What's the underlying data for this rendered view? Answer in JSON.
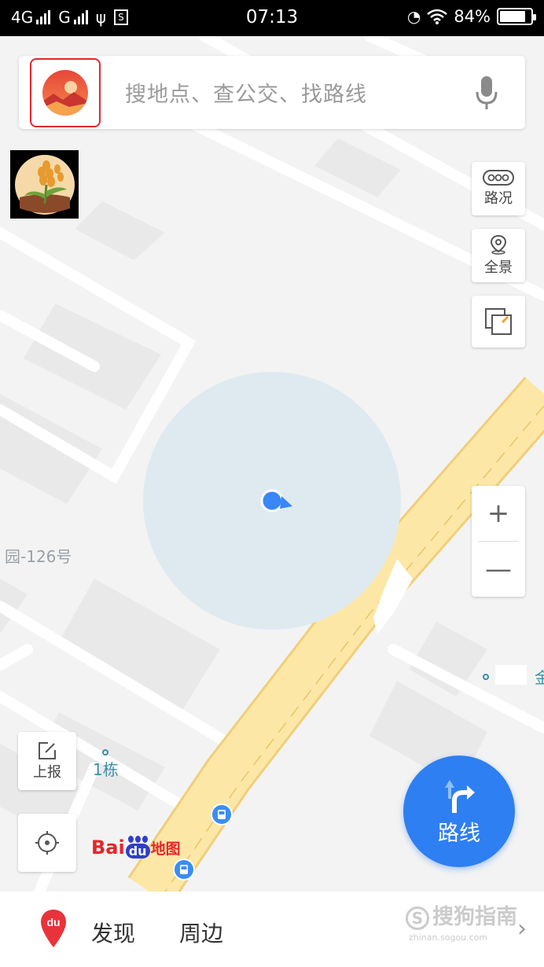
{
  "status_bar": {
    "network_1": "4G",
    "network_2": "G",
    "time": "07:13",
    "battery_percent": "84%",
    "battery_level": 0.84
  },
  "search": {
    "placeholder": "搜地点、查公交、找路线"
  },
  "side_controls": {
    "traffic_label": "路况",
    "panorama_label": "全景"
  },
  "zoom": {
    "in_symbol": "+",
    "out_symbol": "—"
  },
  "map_labels": {
    "address": "园-126号",
    "building": "1栋",
    "poi_right": "金"
  },
  "report_button": {
    "label": "上报"
  },
  "route_button": {
    "label": "路线"
  },
  "logo": {
    "bai": "Bai",
    "du": "du",
    "map": "地图"
  },
  "bottom_bar": {
    "discover_prefix": "发现",
    "discover_suffix": "周边",
    "chevron": "›"
  },
  "watermark": {
    "text": "搜狗指南",
    "url": "zhinan.sogou.com"
  },
  "colors": {
    "accent_blue": "#2e7ff1",
    "road_yellow": "#fde7a6",
    "highlight_red": "#e0282b",
    "location_circle": "#dfeaf0"
  }
}
